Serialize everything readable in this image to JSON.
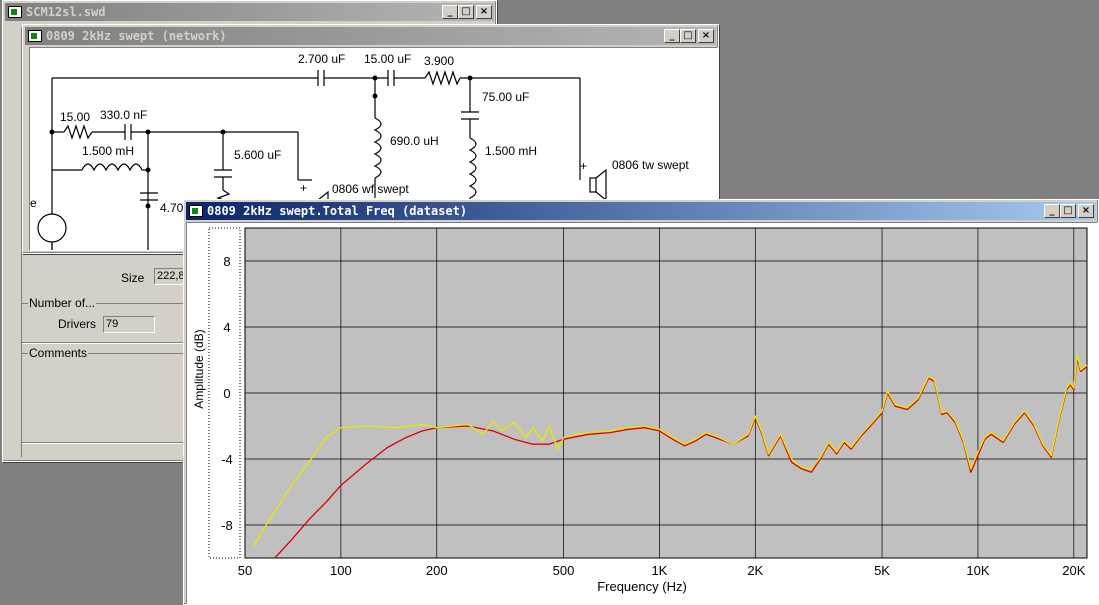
{
  "project_window": {
    "title": "SCM12sl.swd",
    "size_label": "Size",
    "size_value": "222,8",
    "number_of_group": "Number of...",
    "drivers_label": "Drivers",
    "drivers_value": "79",
    "comments_group": "Comments"
  },
  "network_window": {
    "title": "0809 2kHz swept (network)",
    "components": {
      "r1": "15.00",
      "c1": "330.0 nF",
      "l1": "1.500 mH",
      "c2": "5.600 uF",
      "c3": "4.70",
      "c4": "2.700 uF",
      "c5": "15.00 uF",
      "r2": "3.900",
      "c6": "75.00 uF",
      "l2": "690.0 uH",
      "l3": "1.500 mH",
      "wf_driver": "0806 wf swept",
      "tw_driver": "0806 tw swept",
      "src_label": "e",
      "plus1": "+",
      "plus2": "+"
    }
  },
  "freq_window": {
    "title": "0809 2kHz swept.Total Freq (dataset)"
  },
  "chart_data": {
    "type": "line",
    "xlabel": "Frequency (Hz)",
    "ylabel": "Amplitude (dB)",
    "x_scale": "log",
    "xlim": [
      50,
      22000
    ],
    "ylim": [
      -10,
      10
    ],
    "x_ticks": [
      50,
      100,
      200,
      500,
      1000,
      2000,
      5000,
      10000,
      20000
    ],
    "x_tick_labels": [
      "50",
      "100",
      "200",
      "500",
      "1K",
      "2K",
      "5K",
      "10K",
      "20K"
    ],
    "y_ticks": [
      8,
      4,
      0,
      -4,
      -8
    ],
    "y_tick_labels": [
      "8",
      "4",
      "0",
      "-4",
      "-8"
    ],
    "grid": true,
    "background": "#c0c0c0",
    "series": [
      {
        "color": "#e00000",
        "points": [
          [
            62,
            -10
          ],
          [
            70,
            -8.9
          ],
          [
            80,
            -7.6
          ],
          [
            90,
            -6.6
          ],
          [
            100,
            -5.6
          ],
          [
            120,
            -4.3
          ],
          [
            140,
            -3.3
          ],
          [
            160,
            -2.7
          ],
          [
            180,
            -2.3
          ],
          [
            200,
            -2.1
          ],
          [
            250,
            -2.0
          ],
          [
            300,
            -2.3
          ],
          [
            350,
            -2.8
          ],
          [
            400,
            -3.1
          ],
          [
            450,
            -3.1
          ],
          [
            500,
            -2.8
          ],
          [
            600,
            -2.5
          ],
          [
            700,
            -2.4
          ],
          [
            800,
            -2.2
          ],
          [
            900,
            -2.1
          ],
          [
            1000,
            -2.3
          ],
          [
            1100,
            -2.8
          ],
          [
            1200,
            -3.2
          ],
          [
            1300,
            -2.9
          ],
          [
            1400,
            -2.5
          ],
          [
            1500,
            -2.7
          ],
          [
            1700,
            -3.1
          ],
          [
            1900,
            -2.6
          ],
          [
            2000,
            -1.5
          ],
          [
            2100,
            -2.5
          ],
          [
            2200,
            -3.8
          ],
          [
            2400,
            -2.6
          ],
          [
            2600,
            -4.2
          ],
          [
            2800,
            -4.6
          ],
          [
            3000,
            -4.8
          ],
          [
            3200,
            -4.0
          ],
          [
            3400,
            -3.1
          ],
          [
            3600,
            -3.7
          ],
          [
            3800,
            -3.0
          ],
          [
            4000,
            -3.4
          ],
          [
            4300,
            -2.6
          ],
          [
            4600,
            -2.0
          ],
          [
            5000,
            -1.2
          ],
          [
            5200,
            0.0
          ],
          [
            5500,
            -0.8
          ],
          [
            6000,
            -1.0
          ],
          [
            6500,
            -0.4
          ],
          [
            7000,
            0.9
          ],
          [
            7300,
            0.7
          ],
          [
            7700,
            -1.3
          ],
          [
            8000,
            -1.2
          ],
          [
            8500,
            -1.8
          ],
          [
            9000,
            -3.0
          ],
          [
            9500,
            -4.8
          ],
          [
            10000,
            -3.8
          ],
          [
            10500,
            -2.8
          ],
          [
            11000,
            -2.5
          ],
          [
            12000,
            -3.0
          ],
          [
            13000,
            -1.9
          ],
          [
            14000,
            -1.2
          ],
          [
            15000,
            -2.0
          ],
          [
            16000,
            -3.2
          ],
          [
            17000,
            -3.9
          ],
          [
            18000,
            -1.6
          ],
          [
            19000,
            0.2
          ],
          [
            19500,
            0.5
          ],
          [
            20000,
            0.2
          ],
          [
            20500,
            2.1
          ],
          [
            21000,
            1.3
          ],
          [
            22000,
            1.6
          ]
        ]
      },
      {
        "color": "#e8e800",
        "points": [
          [
            53,
            -9.3
          ],
          [
            60,
            -7.6
          ],
          [
            70,
            -5.6
          ],
          [
            80,
            -4.1
          ],
          [
            90,
            -2.7
          ],
          [
            100,
            -2.1
          ],
          [
            120,
            -2.0
          ],
          [
            150,
            -2.1
          ],
          [
            180,
            -1.9
          ],
          [
            200,
            -2.1
          ],
          [
            250,
            -1.9
          ],
          [
            280,
            -2.5
          ],
          [
            300,
            -1.7
          ],
          [
            320,
            -2.3
          ],
          [
            350,
            -1.8
          ],
          [
            380,
            -2.7
          ],
          [
            400,
            -2.1
          ],
          [
            430,
            -2.9
          ],
          [
            450,
            -2.0
          ],
          [
            480,
            -3.4
          ],
          [
            500,
            -2.7
          ],
          [
            550,
            -2.5
          ],
          [
            600,
            -2.4
          ],
          [
            700,
            -2.3
          ],
          [
            800,
            -2.1
          ],
          [
            900,
            -2.0
          ],
          [
            1000,
            -2.2
          ],
          [
            1100,
            -2.7
          ],
          [
            1200,
            -3.1
          ],
          [
            1300,
            -2.8
          ],
          [
            1400,
            -2.4
          ],
          [
            1500,
            -2.6
          ],
          [
            1700,
            -3.1
          ],
          [
            1900,
            -2.5
          ],
          [
            2000,
            -1.4
          ],
          [
            2100,
            -2.4
          ],
          [
            2200,
            -3.7
          ],
          [
            2400,
            -2.5
          ],
          [
            2600,
            -4.0
          ],
          [
            2800,
            -4.5
          ],
          [
            3000,
            -4.6
          ],
          [
            3200,
            -3.9
          ],
          [
            3400,
            -3.0
          ],
          [
            3600,
            -3.6
          ],
          [
            3800,
            -2.9
          ],
          [
            4000,
            -3.3
          ],
          [
            4300,
            -2.5
          ],
          [
            4600,
            -1.9
          ],
          [
            5000,
            -1.1
          ],
          [
            5200,
            0.1
          ],
          [
            5500,
            -0.7
          ],
          [
            6000,
            -0.9
          ],
          [
            6500,
            -0.3
          ],
          [
            7000,
            1.0
          ],
          [
            7300,
            0.8
          ],
          [
            7700,
            -1.2
          ],
          [
            8000,
            -1.1
          ],
          [
            8500,
            -1.7
          ],
          [
            9000,
            -2.9
          ],
          [
            9500,
            -4.6
          ],
          [
            10000,
            -3.6
          ],
          [
            10500,
            -2.7
          ],
          [
            11000,
            -2.4
          ],
          [
            12000,
            -2.9
          ],
          [
            13000,
            -1.8
          ],
          [
            14000,
            -1.1
          ],
          [
            15000,
            -1.9
          ],
          [
            16000,
            -3.1
          ],
          [
            17000,
            -3.8
          ],
          [
            18000,
            -1.5
          ],
          [
            19000,
            0.3
          ],
          [
            19500,
            0.6
          ],
          [
            20000,
            0.3
          ],
          [
            20500,
            2.3
          ],
          [
            21000,
            1.4
          ],
          [
            22000,
            1.7
          ]
        ]
      }
    ]
  }
}
